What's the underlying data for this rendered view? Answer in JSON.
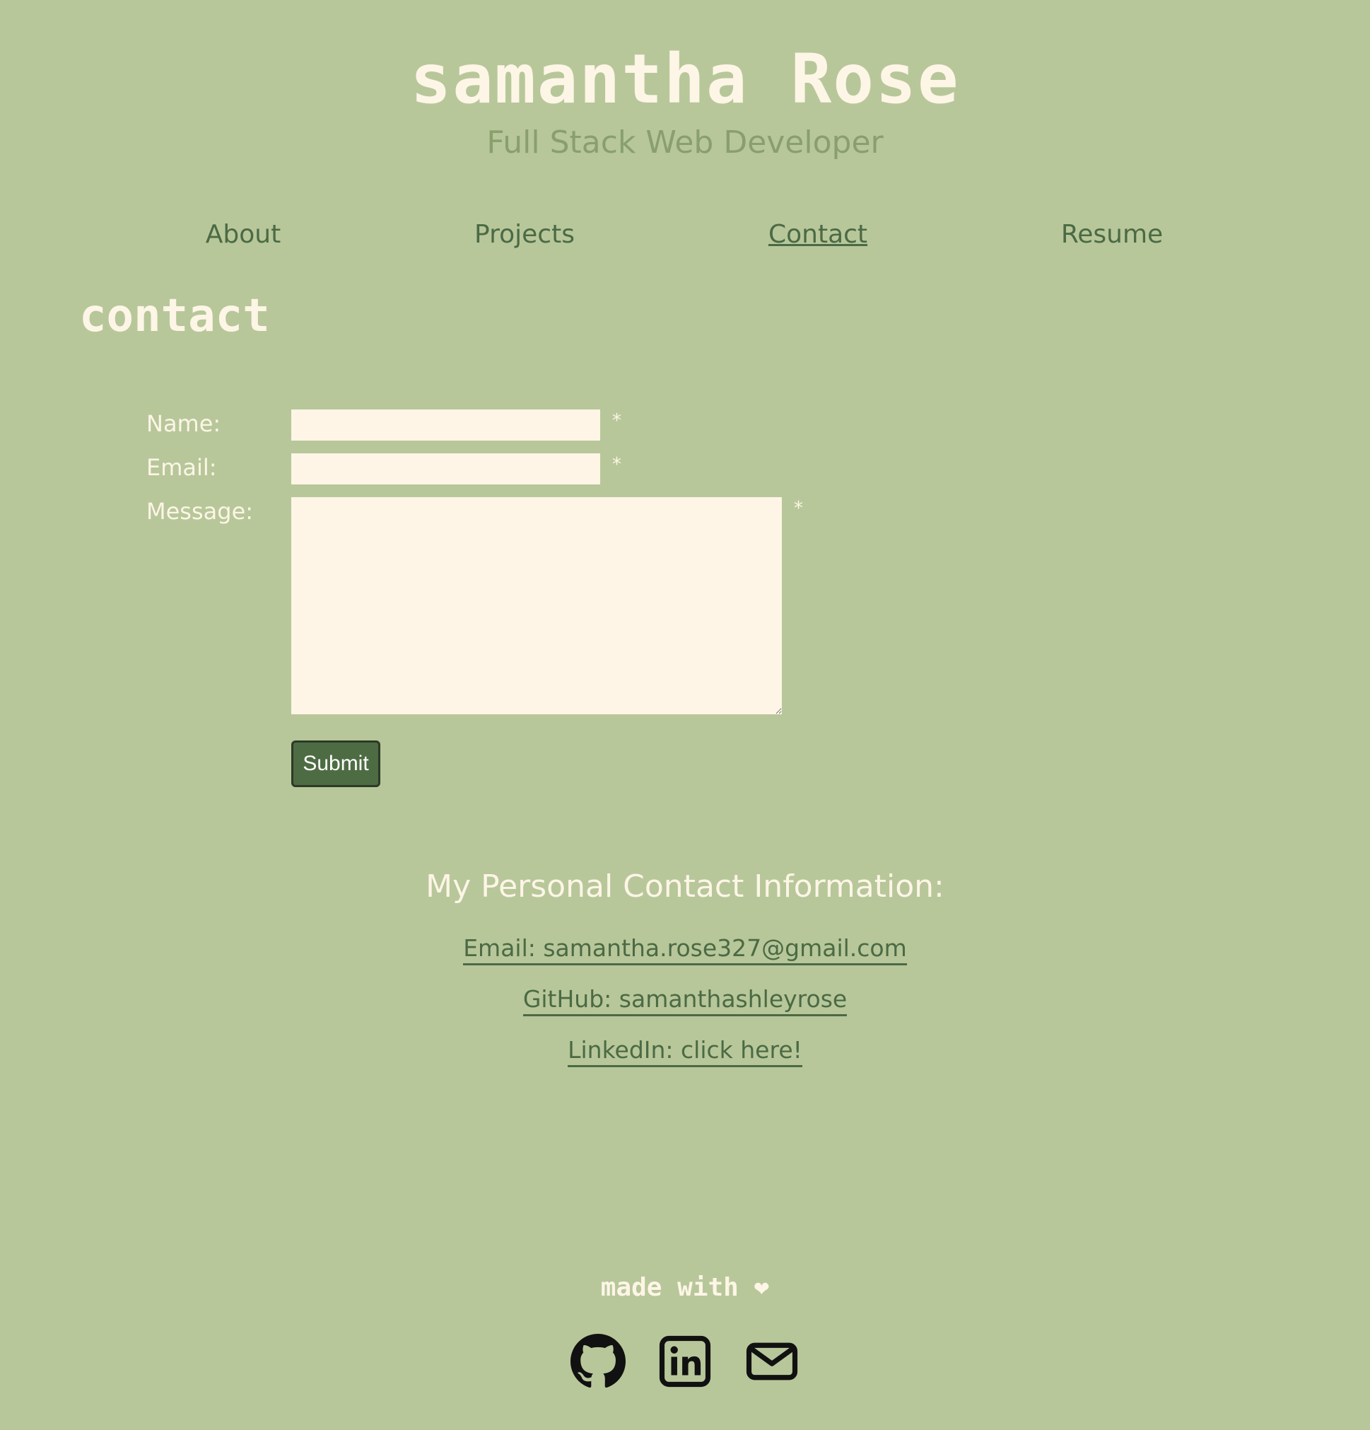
{
  "header": {
    "title": "samantha Rose",
    "subtitle": "Full Stack Web Developer"
  },
  "nav": {
    "items": [
      {
        "label": "About",
        "active": false
      },
      {
        "label": "Projects",
        "active": false
      },
      {
        "label": "Contact",
        "active": true
      },
      {
        "label": "Resume",
        "active": false
      }
    ]
  },
  "section": {
    "heading": "contact"
  },
  "form": {
    "name_label": "Name:",
    "email_label": "Email:",
    "message_label": "Message:",
    "required_mark": "*",
    "submit_label": "Submit"
  },
  "contact_info": {
    "heading": "My Personal Contact Information:",
    "email_link": "Email: samantha.rose327@gmail.com",
    "github_link": "GitHub: samanthashleyrose",
    "linkedin_link": "LinkedIn: click here!"
  },
  "footer": {
    "made_with": "made with ❤",
    "icons": [
      "github-icon",
      "linkedin-icon",
      "mail-icon"
    ]
  },
  "colors": {
    "background": "#b7c79a",
    "cream": "#fdf5e6",
    "dark_green": "#4b6a44",
    "muted_green": "#899f6d"
  }
}
